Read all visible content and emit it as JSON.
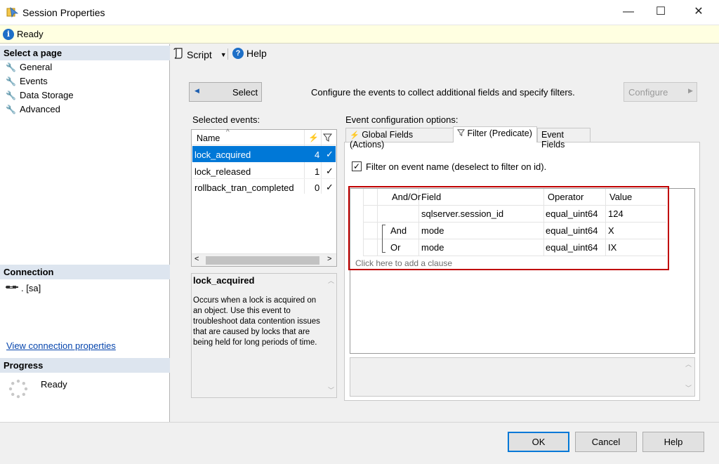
{
  "window": {
    "title": "Session Properties",
    "minimize": "—",
    "maximize": "☐",
    "close": "✕"
  },
  "status": {
    "icon_letter": "i",
    "text": "Ready"
  },
  "left": {
    "select_page_header": "Select a page",
    "pages": [
      {
        "label": "General"
      },
      {
        "label": "Events"
      },
      {
        "label": "Data Storage"
      },
      {
        "label": "Advanced"
      }
    ],
    "connection_header": "Connection",
    "connection_value": ". [sa]",
    "view_connection_link": "View connection properties",
    "progress_header": "Progress",
    "progress_text": "Ready"
  },
  "toolbar": {
    "script_label": "Script",
    "help_label": "Help"
  },
  "main": {
    "select_button": "Select",
    "instruction": "Configure the events to collect additional fields and specify filters.",
    "configure_button": "Configure",
    "selected_events_label": "Selected events:",
    "event_config_label": "Event configuration options:",
    "name_header": "Name",
    "events": [
      {
        "name": "lock_acquired",
        "count": "4",
        "check": "✓"
      },
      {
        "name": "lock_released",
        "count": "1",
        "check": "✓"
      },
      {
        "name": "rollback_tran_completed",
        "count": "0",
        "check": "✓"
      }
    ],
    "description_title": "lock_acquired",
    "description_text": "Occurs when a lock is acquired on an object. Use this event to troubleshoot data contention issues that are caused by locks that are being held for long periods of time."
  },
  "tabs": [
    {
      "label": "Global Fields (Actions)"
    },
    {
      "label": "Filter (Predicate)"
    },
    {
      "label": "Event Fields"
    }
  ],
  "filter": {
    "checkbox_label": "Filter on event name (deselect to filter on id).",
    "checkbox_checked": true,
    "columns": {
      "andor": "And/Or",
      "field": "Field",
      "operator": "Operator",
      "value": "Value"
    },
    "rows": [
      {
        "andor": "",
        "field": "sqlserver.session_id",
        "operator": "equal_uint64",
        "value": "124"
      },
      {
        "andor": "And",
        "field": "mode",
        "operator": "equal_uint64",
        "value": "X"
      },
      {
        "andor": "Or",
        "field": "mode",
        "operator": "equal_uint64",
        "value": "IX"
      }
    ],
    "add_clause": "Click here to add a clause"
  },
  "footer": {
    "ok": "OK",
    "cancel": "Cancel",
    "help": "Help"
  }
}
